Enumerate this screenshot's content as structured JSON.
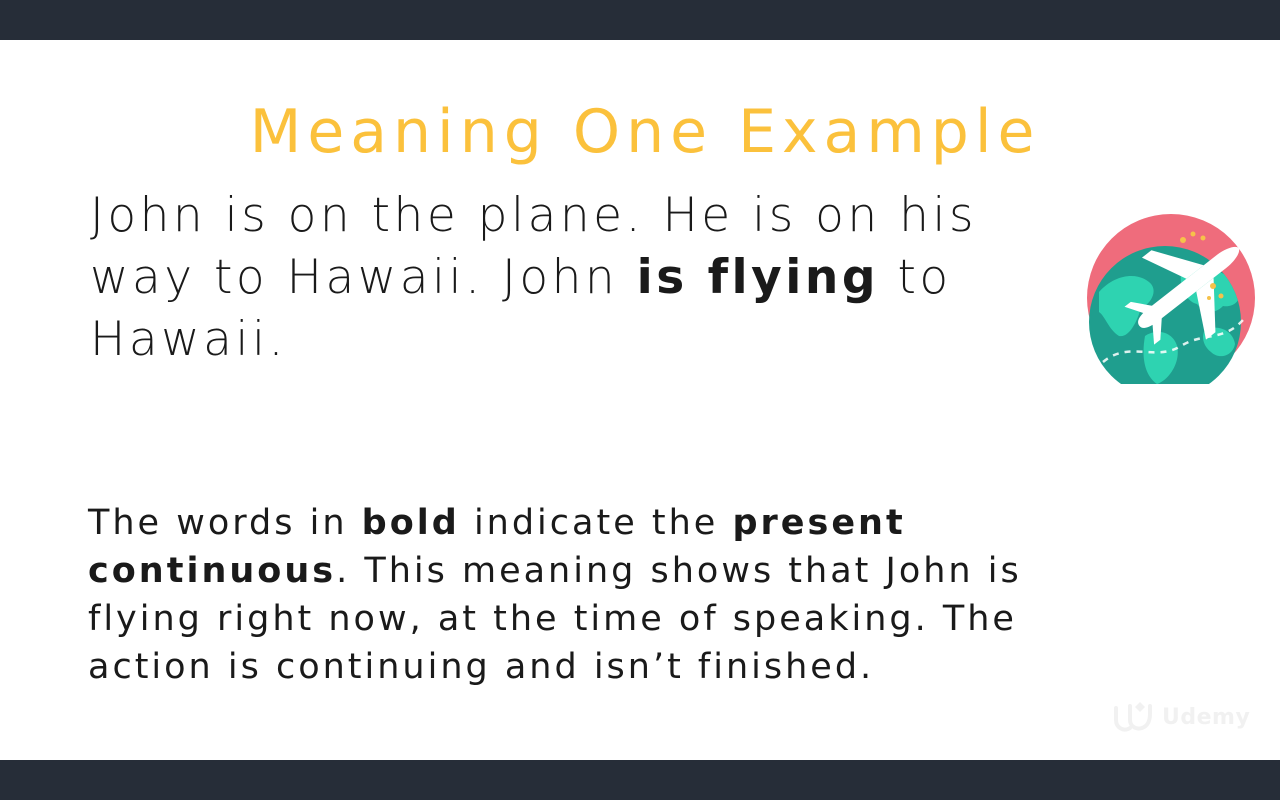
{
  "slide": {
    "title": "Meaning One Example",
    "example": {
      "part1": "John is on the plane. He is on his way to Hawaii. John ",
      "bold": "is flying",
      "part2": " to Hawaii."
    },
    "explanation": {
      "part1": "The words in ",
      "bold1": "bold",
      "part2": " indicate the ",
      "bold2": "present continuous",
      "part3": ". This meaning shows that John is flying right now, at the time of speaking. The action is continuing and isn’t finished."
    }
  },
  "illustration": {
    "icon": "globe-airplane-icon",
    "colors": {
      "circle": "#ef6c7c",
      "ocean": "#1f9e8e",
      "land": "#2ed3b1",
      "airplane": "#ffffff",
      "sparkle": "#f6c24a"
    }
  },
  "watermark": {
    "text": "Udemy",
    "color": "#d8d8d8"
  },
  "theme": {
    "title_color": "#fbc13c",
    "text_color": "#1a1a1a",
    "letterbox_color": "#262d38"
  }
}
